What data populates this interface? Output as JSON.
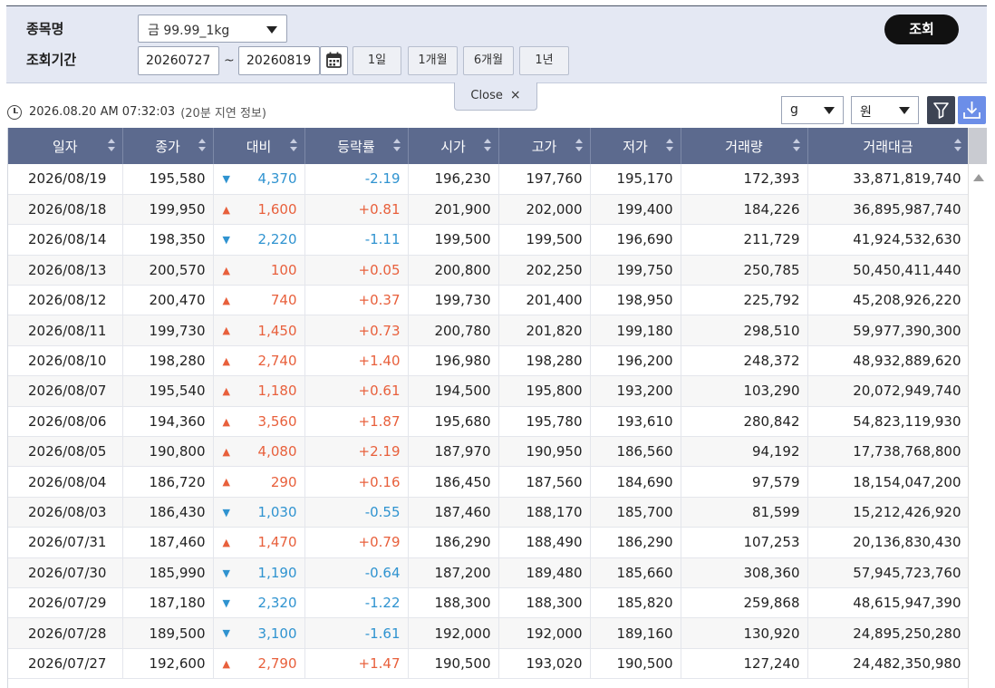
{
  "search": {
    "item_label": "종목명",
    "item_value": "금 99.99_1kg",
    "period_label": "조회기간",
    "date_from": "20260727",
    "date_to": "20260819",
    "tilde": "~",
    "period_buttons": [
      "1일",
      "1개월",
      "6개월",
      "1년"
    ],
    "query_label": "조회",
    "close_label": "Close",
    "close_icon": "×"
  },
  "info": {
    "timestamp": "2026.08.20 AM 07:32:03",
    "delay_note": "(20분 지연 정보)"
  },
  "units": {
    "weight": "g",
    "currency": "원"
  },
  "colors": {
    "up": "#e8603c",
    "down": "#2f93d0",
    "header": "#5c6a8e"
  },
  "table": {
    "columns": [
      "일자",
      "종가",
      "대비",
      "등락률",
      "시가",
      "고가",
      "저가",
      "거래량",
      "거래대금"
    ],
    "rows": [
      {
        "date": "2026/08/19",
        "close": "195,580",
        "dir": "down",
        "change": "4,370",
        "rate": "-2.19",
        "open": "196,230",
        "high": "197,760",
        "low": "195,170",
        "volume": "172,393",
        "amount": "33,871,819,740"
      },
      {
        "date": "2026/08/18",
        "close": "199,950",
        "dir": "up",
        "change": "1,600",
        "rate": "+0.81",
        "open": "201,900",
        "high": "202,000",
        "low": "199,400",
        "volume": "184,226",
        "amount": "36,895,987,740"
      },
      {
        "date": "2026/08/14",
        "close": "198,350",
        "dir": "down",
        "change": "2,220",
        "rate": "-1.11",
        "open": "199,500",
        "high": "199,500",
        "low": "196,690",
        "volume": "211,729",
        "amount": "41,924,532,630"
      },
      {
        "date": "2026/08/13",
        "close": "200,570",
        "dir": "up",
        "change": "100",
        "rate": "+0.05",
        "open": "200,800",
        "high": "202,250",
        "low": "199,750",
        "volume": "250,785",
        "amount": "50,450,411,440"
      },
      {
        "date": "2026/08/12",
        "close": "200,470",
        "dir": "up",
        "change": "740",
        "rate": "+0.37",
        "open": "199,730",
        "high": "201,400",
        "low": "198,950",
        "volume": "225,792",
        "amount": "45,208,926,220"
      },
      {
        "date": "2026/08/11",
        "close": "199,730",
        "dir": "up",
        "change": "1,450",
        "rate": "+0.73",
        "open": "200,780",
        "high": "201,820",
        "low": "199,180",
        "volume": "298,510",
        "amount": "59,977,390,300"
      },
      {
        "date": "2026/08/10",
        "close": "198,280",
        "dir": "up",
        "change": "2,740",
        "rate": "+1.40",
        "open": "196,980",
        "high": "198,280",
        "low": "196,200",
        "volume": "248,372",
        "amount": "48,932,889,620"
      },
      {
        "date": "2026/08/07",
        "close": "195,540",
        "dir": "up",
        "change": "1,180",
        "rate": "+0.61",
        "open": "194,500",
        "high": "195,800",
        "low": "193,200",
        "volume": "103,290",
        "amount": "20,072,949,740"
      },
      {
        "date": "2026/08/06",
        "close": "194,360",
        "dir": "up",
        "change": "3,560",
        "rate": "+1.87",
        "open": "195,680",
        "high": "195,780",
        "low": "193,610",
        "volume": "280,842",
        "amount": "54,823,119,930"
      },
      {
        "date": "2026/08/05",
        "close": "190,800",
        "dir": "up",
        "change": "4,080",
        "rate": "+2.19",
        "open": "187,970",
        "high": "190,950",
        "low": "186,560",
        "volume": "94,192",
        "amount": "17,738,768,800"
      },
      {
        "date": "2026/08/04",
        "close": "186,720",
        "dir": "up",
        "change": "290",
        "rate": "+0.16",
        "open": "186,450",
        "high": "187,560",
        "low": "184,690",
        "volume": "97,579",
        "amount": "18,154,047,200"
      },
      {
        "date": "2026/08/03",
        "close": "186,430",
        "dir": "down",
        "change": "1,030",
        "rate": "-0.55",
        "open": "187,460",
        "high": "188,170",
        "low": "185,700",
        "volume": "81,599",
        "amount": "15,212,426,920"
      },
      {
        "date": "2026/07/31",
        "close": "187,460",
        "dir": "up",
        "change": "1,470",
        "rate": "+0.79",
        "open": "186,290",
        "high": "188,490",
        "low": "186,290",
        "volume": "107,253",
        "amount": "20,136,830,430"
      },
      {
        "date": "2026/07/30",
        "close": "185,990",
        "dir": "down",
        "change": "1,190",
        "rate": "-0.64",
        "open": "187,200",
        "high": "189,480",
        "low": "185,660",
        "volume": "308,360",
        "amount": "57,945,723,760"
      },
      {
        "date": "2026/07/29",
        "close": "187,180",
        "dir": "down",
        "change": "2,320",
        "rate": "-1.22",
        "open": "188,300",
        "high": "188,300",
        "low": "185,820",
        "volume": "259,868",
        "amount": "48,615,947,390"
      },
      {
        "date": "2026/07/28",
        "close": "189,500",
        "dir": "down",
        "change": "3,100",
        "rate": "-1.61",
        "open": "192,000",
        "high": "192,000",
        "low": "189,160",
        "volume": "130,920",
        "amount": "24,895,250,280"
      },
      {
        "date": "2026/07/27",
        "close": "192,600",
        "dir": "up",
        "change": "2,790",
        "rate": "+1.47",
        "open": "190,500",
        "high": "193,020",
        "low": "190,500",
        "volume": "127,240",
        "amount": "24,482,350,980"
      }
    ]
  }
}
